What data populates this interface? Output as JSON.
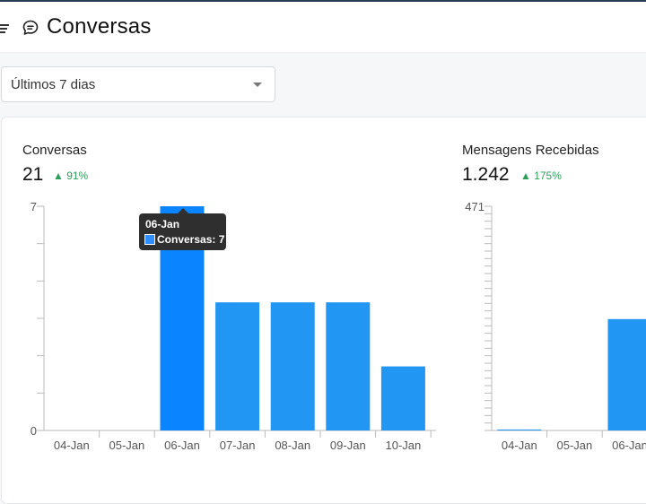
{
  "header": {
    "title": "Conversas"
  },
  "filter": {
    "selected": "Últimos 7 dias"
  },
  "metrics": [
    {
      "title": "Conversas",
      "value": "21",
      "delta": "▲ 91%"
    },
    {
      "title": "Mensagens Recebidas",
      "value": "1.242",
      "delta": "▲ 175%"
    }
  ],
  "colors": {
    "bar": "#2196f3",
    "bar_highlight": "#0a84ff",
    "delta_up": "#2e9e5b"
  },
  "tooltip": {
    "title": "06-Jan",
    "text": "Conversas: 7"
  },
  "chart_data": [
    {
      "type": "bar",
      "title": "Conversas",
      "categories": [
        "04-Jan",
        "05-Jan",
        "06-Jan",
        "07-Jan",
        "08-Jan",
        "09-Jan",
        "10-Jan"
      ],
      "values": [
        0,
        0,
        7,
        4,
        4,
        4,
        2
      ],
      "ylim": [
        0,
        7
      ],
      "y_tick_labels": [
        "0",
        "7"
      ],
      "highlighted_category": "06-Jan"
    },
    {
      "type": "bar",
      "title": "Mensagens Recebidas",
      "categories": [
        "04-Jan",
        "05-Jan",
        "06-Jan"
      ],
      "values": [
        2,
        0,
        234
      ],
      "ylim": [
        0,
        471
      ],
      "y_tick_labels": [
        "471"
      ]
    }
  ]
}
